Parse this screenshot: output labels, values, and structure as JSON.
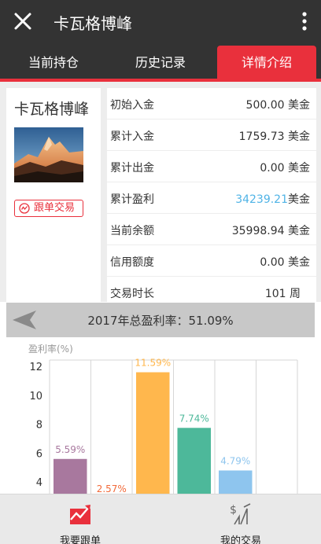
{
  "header": {
    "title": "卡瓦格博峰",
    "close_icon": "close-icon",
    "more_icon": "more-vertical-icon"
  },
  "tabs": [
    {
      "label": "当前持仓",
      "active": false
    },
    {
      "label": "历史记录",
      "active": false
    },
    {
      "label": "详情介绍",
      "active": true
    }
  ],
  "profile": {
    "name": "卡瓦格博峰",
    "follow_label": "跟单交易"
  },
  "stats": [
    {
      "label": "初始入金",
      "value": "500.00",
      "unit": "美金",
      "highlight": false
    },
    {
      "label": "累计入金",
      "value": "1759.73",
      "unit": "美金",
      "highlight": false
    },
    {
      "label": "累计出金",
      "value": "0.00",
      "unit": "美金",
      "highlight": false
    },
    {
      "label": "累计盈利",
      "value": "34239.21",
      "unit": "美金",
      "highlight": true
    },
    {
      "label": "当前余额",
      "value": "35998.94",
      "unit": "美金",
      "highlight": false
    },
    {
      "label": "信用额度",
      "value": "0.00",
      "unit": "美金",
      "highlight": false
    },
    {
      "label": "交易时长",
      "value": "101",
      "unit": "周",
      "highlight": false
    }
  ],
  "banner": {
    "text": "2017年总盈利率：51.09%"
  },
  "chart_data": {
    "type": "bar",
    "ylabel": "盈利率(%)",
    "ylim": [
      2.5,
      12
    ],
    "yticks": [
      4,
      6,
      8,
      10,
      12
    ],
    "bars": [
      {
        "value": 5.59,
        "label": "5.59%",
        "color": "#a8789e"
      },
      {
        "value": 2.57,
        "label": "2.57%",
        "color": "#f26a3a"
      },
      {
        "value": 11.59,
        "label": "11.59%",
        "color": "#ffb74d"
      },
      {
        "value": 7.74,
        "label": "7.74%",
        "color": "#4db89a"
      },
      {
        "value": 4.79,
        "label": "4.79%",
        "color": "#8ec5ee"
      },
      {
        "value": null,
        "label": "",
        "color": "#cccccc"
      }
    ]
  },
  "bottom_nav": [
    {
      "label": "我要跟单",
      "icon": "chart-trend-icon"
    },
    {
      "label": "我的交易",
      "icon": "dollar-trade-icon"
    }
  ]
}
